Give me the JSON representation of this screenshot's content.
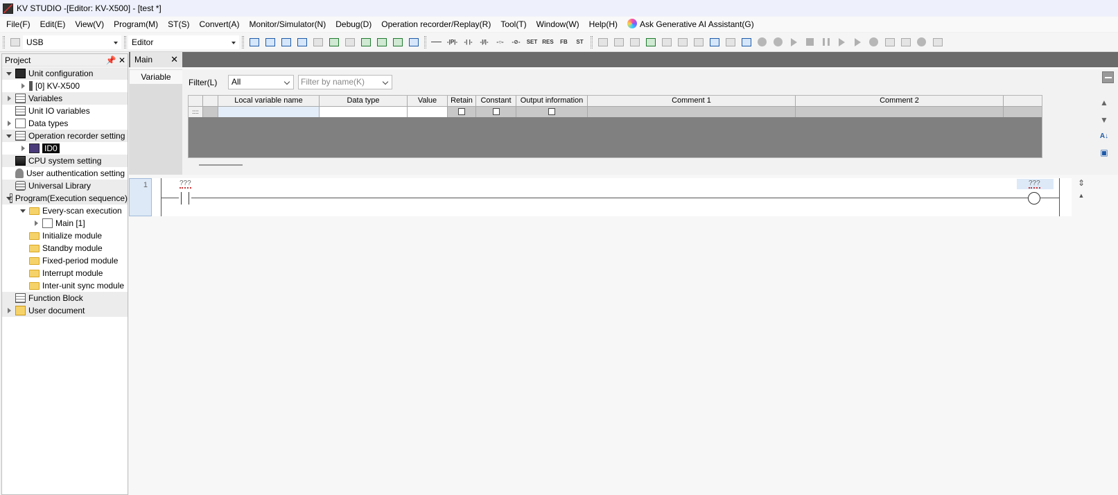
{
  "window": {
    "title": "KV STUDIO -[Editor: KV-X500] - [test *]"
  },
  "menu": [
    "File(F)",
    "Edit(E)",
    "View(V)",
    "Program(M)",
    "ST(S)",
    "Convert(A)",
    "Monitor/Simulator(N)",
    "Debug(D)",
    "Operation recorder/Replay(R)",
    "Tool(T)",
    "Window(W)",
    "Help(H)"
  ],
  "ai_assistant": "Ask Generative AI Assistant(G)",
  "toolbar": {
    "connection": "USB",
    "mode": "Editor",
    "labels": {
      "set": "SET",
      "res": "RES",
      "fb": "FB",
      "st": "ST"
    }
  },
  "project": {
    "title": "Project",
    "tree": {
      "unit_config": "Unit configuration",
      "unit_kv": "[0]  KV-X500",
      "variables": "Variables",
      "unit_io": "Unit IO variables",
      "data_types": "Data types",
      "op_recorder": "Operation recorder setting",
      "id0": "ID0",
      "cpu": "CPU system setting",
      "user_auth": "User authentication setting",
      "univ_lib": "Universal Library",
      "program": "Program(Execution sequence)",
      "every_scan": "Every-scan execution",
      "main": "Main [1]",
      "init_mod": "Initialize module",
      "standby_mod": "Standby module",
      "fixed_mod": "Fixed-period module",
      "interrupt_mod": "Interrupt module",
      "intersync_mod": "Inter-unit sync module",
      "function_block": "Function Block",
      "user_doc": "User document"
    }
  },
  "editor": {
    "tab": "Main",
    "variable_tab": "Variable",
    "filter_label": "Filter(L)",
    "filter_value": "All",
    "filter_name_placeholder": "Filter by name(K)",
    "columns": [
      "Local variable name",
      "Data type",
      "Value",
      "Retain",
      "Constant",
      "Output information",
      "Comment 1",
      "Comment 2"
    ],
    "row_handle": "::::",
    "rung_number": "1",
    "contact_label": "???",
    "coil_label": "???"
  }
}
